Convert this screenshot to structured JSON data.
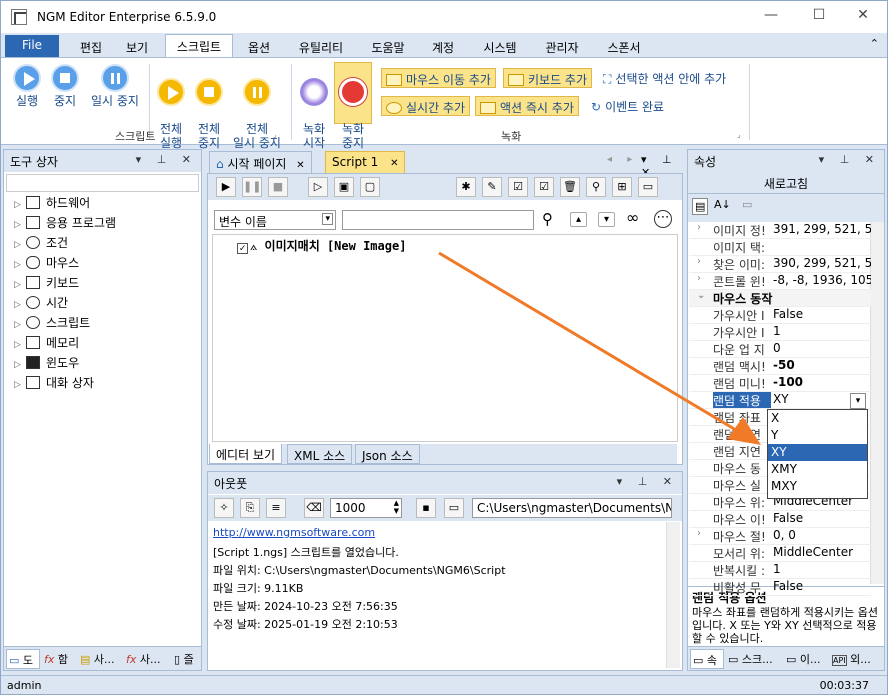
{
  "window": {
    "title": "NGM Editor   Enterprise 6.5.9.0",
    "minimize": "—",
    "maximize": "☐",
    "close": "✕"
  },
  "menu": {
    "file": "File",
    "items": [
      "편집",
      "보기",
      "스크립트",
      "옵션",
      "유틸리티",
      "도움말",
      "계정",
      "시스템",
      "관리자",
      "스폰서"
    ]
  },
  "ribbon": {
    "script_buttons": [
      "실행",
      "중지",
      "일시 중지"
    ],
    "all_buttons": [
      "전체\n실행",
      "전체\n중지",
      "전체\n일시 중지"
    ],
    "script_group": "스크립트",
    "record_buttons": [
      "녹화\n시작",
      "녹화\n중지"
    ],
    "action_buttons": [
      "마우스 이동 추가",
      "키보드 추가",
      "선택한 액션 안에 추가",
      "실시간 추가",
      "액션 즉시 추가",
      "이벤트 완료"
    ],
    "record_group": "녹화"
  },
  "toolbox": {
    "title": "도구 상자",
    "items": [
      "하드웨어",
      "응용 프로그램",
      "조건",
      "마우스",
      "키보드",
      "시간",
      "스크립트",
      "메모리",
      "윈도우",
      "대화 상자"
    ],
    "bottom_tabs": [
      "도",
      "함",
      "사...",
      "사...",
      "즐"
    ]
  },
  "editor": {
    "tabs": [
      "시작 페이지",
      "Script 1"
    ],
    "var_select": "변수 이름",
    "line": "이미지매치 [New Image]",
    "view_tabs": [
      "에디터 보기",
      "XML 소스",
      "Json 소스"
    ]
  },
  "output": {
    "title": "아웃풋",
    "count": "1000",
    "path": "C:\\Users\\ngmaster\\Documents\\NGM",
    "lines": [
      "http://www.ngmsoftware.com",
      "[Script 1.ngs] 스크립트를 열었습니다.",
      "파일 위치: C:\\Users\\ngmaster\\Documents\\NGM6\\Script",
      "파일 크기: 9.11KB",
      "만든 날짜: 2024-10-23 오전 7:56:35",
      "수정 날짜: 2025-01-19 오전 2:10:53"
    ]
  },
  "properties": {
    "title": "속성",
    "refresh": "새로고침",
    "rows": [
      {
        "name": "이미지 정!",
        "value": "391, 299, 521, 523",
        "expander": "›",
        "kind": "normal"
      },
      {
        "name": "이미지 택:",
        "value": "",
        "expander": "",
        "kind": "normal"
      },
      {
        "name": "찾은 이미:",
        "value": "390, 299, 521, 523",
        "expander": "›",
        "kind": "normal"
      },
      {
        "name": "콘트롤 윈!",
        "value": "-8, -8, 1936, 1056",
        "expander": "›",
        "kind": "normal"
      },
      {
        "name": "마우스 동작",
        "value": "",
        "expander": "⌄",
        "kind": "category"
      },
      {
        "name": "가우시안 I",
        "value": "False",
        "expander": "",
        "kind": "normal"
      },
      {
        "name": "가우시안 I",
        "value": "1",
        "expander": "",
        "kind": "normal"
      },
      {
        "name": "다운 업 지",
        "value": "0",
        "expander": "",
        "kind": "normal"
      },
      {
        "name": "랜덤 맥시!",
        "value": "-50",
        "expander": "",
        "kind": "bold"
      },
      {
        "name": "랜덤 미니!",
        "value": "-100",
        "expander": "",
        "kind": "bold"
      },
      {
        "name": "랜덤 적용",
        "value": "XY",
        "expander": "",
        "kind": "selected"
      },
      {
        "name": "랜덤 좌표",
        "value": "",
        "expander": "",
        "kind": "normal"
      },
      {
        "name": "랜덤 지연",
        "value": "",
        "expander": "",
        "kind": "normal"
      },
      {
        "name": "랜덤 지연",
        "value": "",
        "expander": "",
        "kind": "normal"
      },
      {
        "name": "마우스 동",
        "value": "",
        "expander": "",
        "kind": "normal"
      },
      {
        "name": "마우스 실",
        "value": "",
        "expander": "",
        "kind": "normal"
      },
      {
        "name": "마우스 위:",
        "value": "MiddleCenter",
        "expander": "",
        "kind": "normal"
      },
      {
        "name": "마우스 이!",
        "value": "False",
        "expander": "",
        "kind": "normal"
      },
      {
        "name": "마우스 절!",
        "value": "0, 0",
        "expander": "›",
        "kind": "normal"
      },
      {
        "name": "모서리 위:",
        "value": "MiddleCenter",
        "expander": "",
        "kind": "normal"
      },
      {
        "name": "반복시킬 :",
        "value": "1",
        "expander": "",
        "kind": "normal"
      },
      {
        "name": "비활성 무",
        "value": "False",
        "expander": "",
        "kind": "normal"
      }
    ],
    "dropdown_options": [
      "X",
      "Y",
      "XY",
      "XMY",
      "MXY"
    ],
    "dropdown_selected": "XY",
    "desc_title": "랜덤 적용 옵션",
    "desc_text": "마우스 좌표를 랜덤하게 적용시키는 옵션입니다. X 또는 Y와 XY 선택적으로 적용할 수 있습니다.",
    "bottom_tabs": [
      "속",
      "스크...",
      "이...",
      "외..."
    ]
  },
  "status": {
    "user": "admin",
    "time": "00:03:37"
  },
  "colors": {
    "accent": "#2b67b3",
    "arrow": "#f07a28",
    "highlight": "#fbe38a"
  }
}
